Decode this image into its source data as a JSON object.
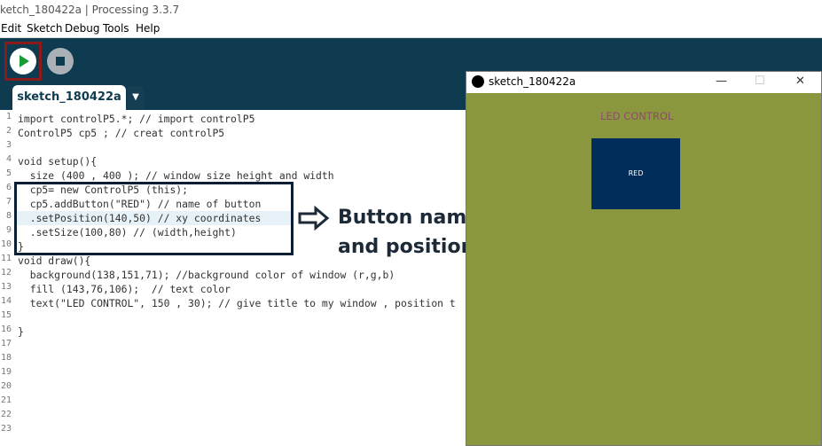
{
  "app": {
    "window_title": "ketch_180422a | Processing 3.3.7"
  },
  "menu": [
    "Edit",
    "Sketch",
    "Debug",
    "Tools",
    "Help"
  ],
  "toolbar": {
    "run_icon": "play-icon",
    "stop_icon": "stop-icon"
  },
  "tab": {
    "label": "sketch_180422a",
    "menu_icon": "▼"
  },
  "editor": {
    "line_numbers": [
      "1",
      "2",
      "3",
      "4",
      "5",
      "6",
      "7",
      "8",
      "9",
      "10",
      "11",
      "12",
      "13",
      "14",
      "15",
      "16",
      "17",
      "18",
      "19",
      "20",
      "21",
      "22",
      "23"
    ],
    "lines": [
      "import controlP5.*; // import controlP5",
      "ControlP5 cp5 ; // creat controlP5",
      "",
      "void setup(){",
      "  size (400 , 400 ); // window size height and width",
      "  cp5= new ControlP5 (this);",
      "  cp5.addButton(\"RED\") // name of button",
      "  .setPosition(140,50) // xy coordinates",
      "  .setSize(100,80) // (width,height)",
      "}",
      "void draw(){",
      "  background(138,151,71); //background color of window (r,g,b)",
      "  fill (143,76,106);  // text color",
      "  text(\"LED CONTROL\", 150 , 30); // give title to my window , position t",
      "",
      "}",
      "",
      "",
      "",
      "",
      "",
      "",
      ""
    ]
  },
  "annotation": {
    "line1": "Button name",
    "line2": "and position"
  },
  "sketch_window": {
    "title": "sketch_180422a",
    "minimize": "—",
    "maximize": "☐",
    "close": "✕",
    "canvas_title": "LED CONTROL",
    "button_label": "RED"
  },
  "colors": {
    "toolbar_bg": "#0e3b4f",
    "canvas_bg": "#8a973f",
    "canvas_text": "#8f4c6a",
    "button_bg": "#002d5a",
    "run_frame": "#8b1a1a"
  }
}
